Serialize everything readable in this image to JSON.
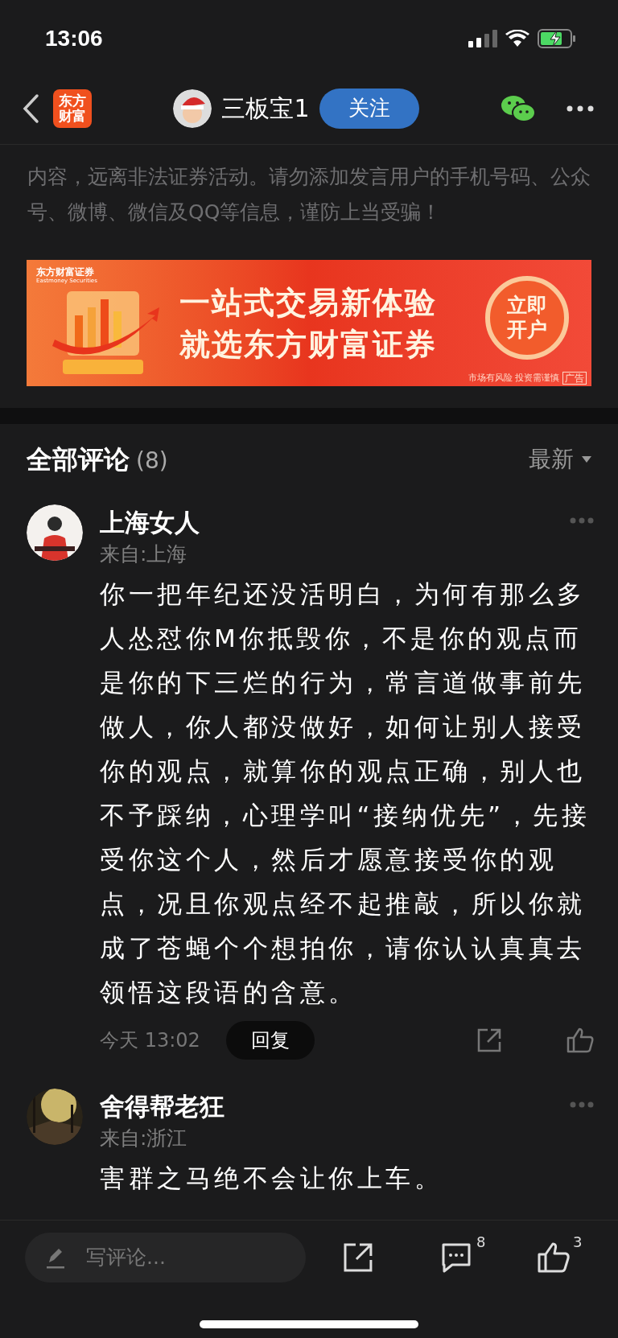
{
  "status_bar": {
    "time": "13:06"
  },
  "header": {
    "logo_lines": [
      "东方",
      "财富"
    ],
    "username": "三板宝1",
    "follow_button": "关注"
  },
  "disclaimer": "内容，远离非法证券活动。请勿添加发言用户的手机号码、公众号、微博、微信及QQ等信息，谨防上当受骗！",
  "banner": {
    "brand": "东方财富证券",
    "brand_en": "Eastmoney Securities",
    "headline_1": "一站式交易新体验",
    "headline_2": "就选东方财富证券",
    "cta_lines": [
      "立即",
      "开户"
    ],
    "risk_note": "市场有风险 投资需谨慎",
    "ad_tag": "广告"
  },
  "comments_section": {
    "title": "全部评论",
    "count": "(8)",
    "sort": "最新"
  },
  "comments": [
    {
      "name": "上海女人",
      "location": "来自:上海",
      "text": "你一把年纪还没活明白，为何有那么多人怂怼你M你抵毁你，不是你的观点而是你的下三烂的行为，常言道做事前先做人，你人都没做好，如何让别人接受你的观点，就算你的观点正确，别人也不予踩纳，心理学叫“接纳优先”，先接受你这个人，然后才愿意接受你的观点，况且你观点经不起推敲，所以你就成了苍蝇个个想拍你，请你认认真真去领悟这段语的含意。",
      "time": "今天 13:02",
      "reply": "回复"
    },
    {
      "name": "舍得帮老狂",
      "location": "来自:浙江",
      "text": "害群之马绝不会让你上车。"
    }
  ],
  "bottom_bar": {
    "placeholder": "写评论...",
    "comment_count": "8",
    "like_count": "3"
  }
}
